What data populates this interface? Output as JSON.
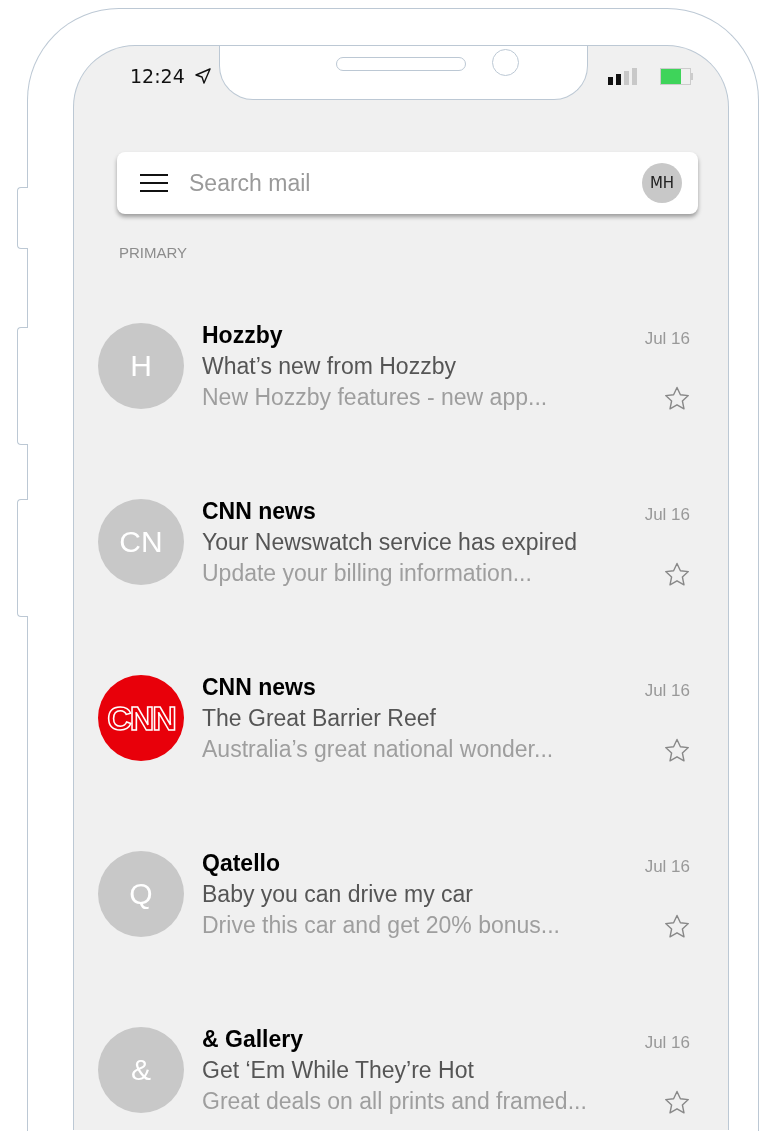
{
  "status_bar": {
    "time": "12:24"
  },
  "search": {
    "placeholder": "Search mail",
    "account_initials": "MH"
  },
  "section_label": "PRIMARY",
  "messages": [
    {
      "avatar": {
        "kind": "letter",
        "text": "H"
      },
      "sender": "Hozzby",
      "subject": "What’s new from Hozzby",
      "preview": "New Hozzby features - new app...",
      "date": "Jul 16",
      "starred": false
    },
    {
      "avatar": {
        "kind": "letter",
        "text": "CN"
      },
      "sender": "CNN news",
      "subject": "Your Newswatch service has expired",
      "preview": "Update your billing information...",
      "date": "Jul 16",
      "starred": false
    },
    {
      "avatar": {
        "kind": "logo",
        "text": "CNN"
      },
      "sender": "CNN news",
      "subject": "The Great Barrier Reef",
      "preview": "Australia’s great national wonder...",
      "date": "Jul 16",
      "starred": false
    },
    {
      "avatar": {
        "kind": "letter",
        "text": "Q"
      },
      "sender": "Qatello",
      "subject": "Baby you can drive my car",
      "preview": "Drive this car and get 20% bonus...",
      "date": "Jul 16",
      "starred": false
    },
    {
      "avatar": {
        "kind": "letter",
        "text": "&"
      },
      "sender": "& Gallery",
      "subject": "Get ‘Em While They’re Hot",
      "preview": "Great deals on all prints and framed...",
      "date": "Jul 16",
      "starred": false
    }
  ]
}
